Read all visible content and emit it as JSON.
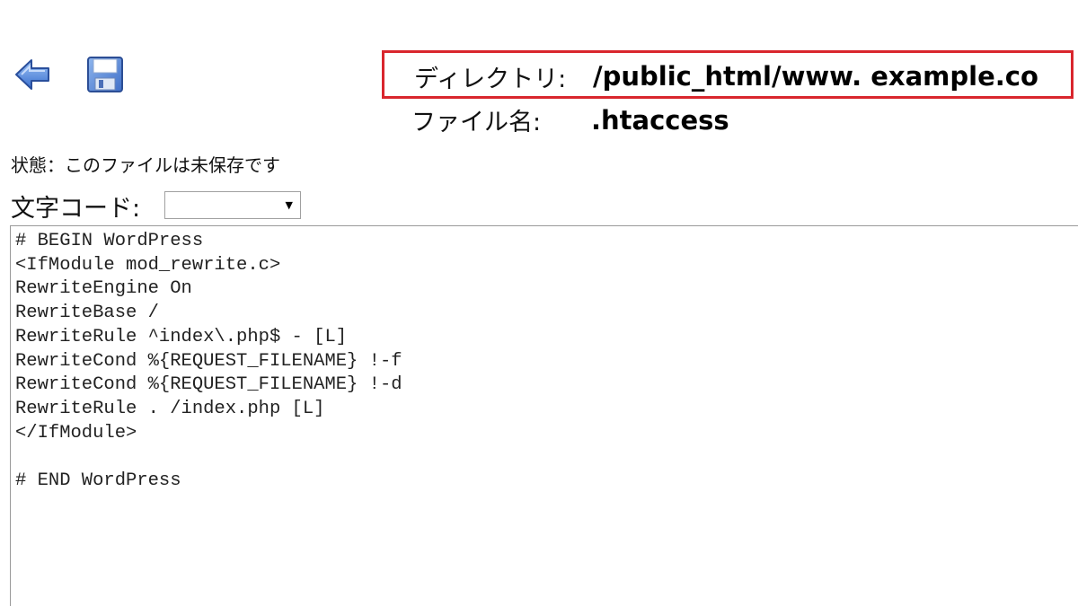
{
  "toolbar": {
    "back_icon": "back-arrow-icon",
    "save_icon": "floppy-disk-icon"
  },
  "header": {
    "directory_label": "ディレクトリ:",
    "directory_value": "/public_html/www. example.co",
    "file_label": "ファイル名:",
    "file_value": ".htaccess"
  },
  "status": {
    "text": "状態：このファイルは未保存です"
  },
  "encoding": {
    "label": "文字コード:",
    "selected": ""
  },
  "editor": {
    "lines": [
      "# BEGIN WordPress",
      "<IfModule mod_rewrite.c>",
      "RewriteEngine On",
      "RewriteBase /",
      "RewriteRule ^index\\.php$ - [L]",
      "RewriteCond %{REQUEST_FILENAME} !-f",
      "RewriteCond %{REQUEST_FILENAME} !-d",
      "RewriteRule . /index.php [L]",
      "</IfModule>",
      "",
      "# END WordPress"
    ]
  },
  "colors": {
    "highlight_border": "#d9262d",
    "icon_blue": "#4a7fd6"
  }
}
